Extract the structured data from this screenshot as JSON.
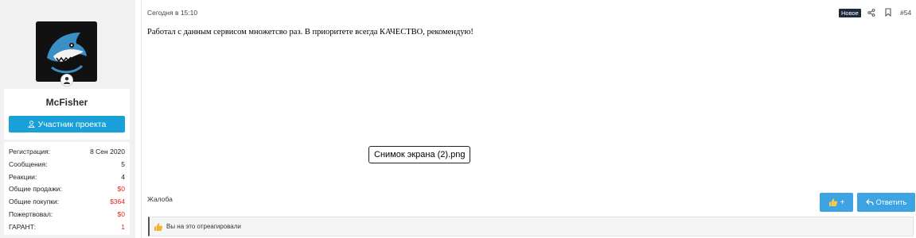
{
  "user": {
    "name": "McFisher",
    "role_button": "Участник проекта",
    "stats": [
      {
        "label": "Регистрация:",
        "value": "8 Сен 2020",
        "color": "#1e1e1e"
      },
      {
        "label": "Сообщения:",
        "value": "5",
        "color": "#1e1e1e"
      },
      {
        "label": "Реакции:",
        "value": "4",
        "color": "#1e1e1e"
      },
      {
        "label": "Общие продажи:",
        "value": "$0",
        "color": "#e4241b"
      },
      {
        "label": "Общие покупки:",
        "value": "$364",
        "color": "#e4241b"
      },
      {
        "label": "Пожертвовал:",
        "value": "$0",
        "color": "#e4241b"
      },
      {
        "label": "ГАРАНТ:",
        "value": "1",
        "color": "#e4241b"
      }
    ]
  },
  "post": {
    "date": "Сегодня в 15:10",
    "badge": "Новое",
    "number": "#54",
    "message": "Работал с данным сервисом множетсво раз. В приоритете всегда КАЧЕСТВО, рекомендую!",
    "attachment": "Снимок экрана (2).png",
    "report": "Жалоба",
    "like_button": "+",
    "reply_button": "Ответить",
    "reactions_text": "Вы на это отреагировали"
  },
  "colors": {
    "accent": "#3ea3e3",
    "role_button": "#1aa0d8",
    "badge": "#1d2a3a",
    "money": "#e4241b"
  },
  "icons": [
    "user-icon",
    "share-icon",
    "bookmark-icon",
    "thumbs-up-icon",
    "reply-icon",
    "shark-logo-icon"
  ]
}
